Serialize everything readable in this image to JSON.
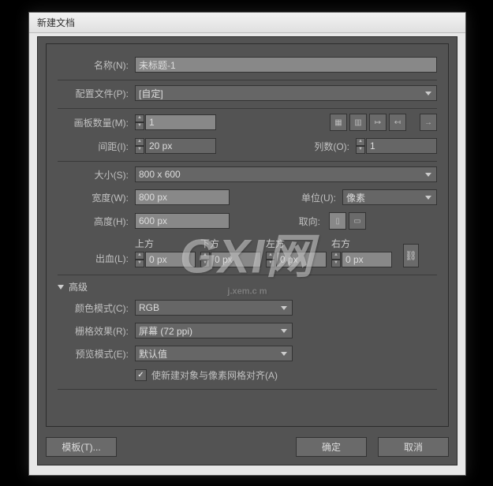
{
  "window": {
    "title": "新建文档"
  },
  "fields": {
    "name": {
      "label": "名称(N):",
      "value": "未标题-1"
    },
    "profile": {
      "label": "配置文件(P):",
      "value": "[自定]"
    },
    "artboards": {
      "label": "画板数量(M):",
      "value": "1"
    },
    "spacing": {
      "label": "间距(I):",
      "value": "20 px"
    },
    "cols": {
      "label": "列数(O):",
      "value": "1"
    },
    "size": {
      "label": "大小(S):",
      "value": "800 x 600"
    },
    "width": {
      "label": "宽度(W):",
      "value": "800 px"
    },
    "height": {
      "label": "高度(H):",
      "value": "600 px"
    },
    "units": {
      "label": "单位(U):",
      "value": "像素"
    },
    "orient": {
      "label": "取向:"
    },
    "bleed": {
      "label": "出血(L):",
      "top": "上方",
      "bottom": "下方",
      "left": "左方",
      "right": "右方",
      "value": "0 px"
    }
  },
  "advanced": {
    "header": "高级",
    "colorMode": {
      "label": "颜色模式(C):",
      "value": "RGB"
    },
    "raster": {
      "label": "栅格效果(R):",
      "value": "屏幕 (72 ppi)"
    },
    "preview": {
      "label": "预览模式(E):",
      "value": "默认值"
    },
    "align": {
      "label": "使新建对象与像素网格对齐(A)",
      "checked": true
    }
  },
  "buttons": {
    "template": "模板(T)...",
    "ok": "确定",
    "cancel": "取消"
  },
  "watermark": {
    "main": "GXI网",
    "sub": "j.xem.c m"
  }
}
